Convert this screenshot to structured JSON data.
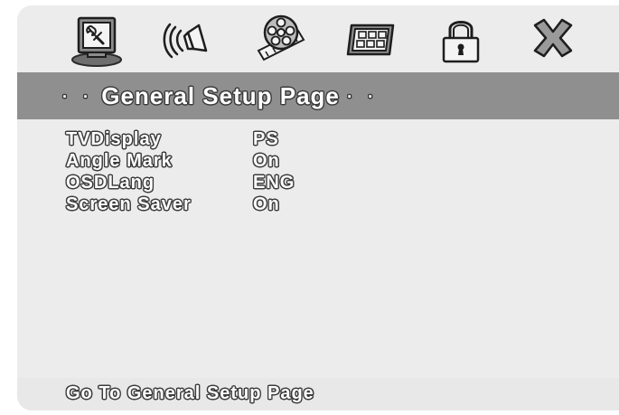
{
  "toolbar": {
    "icons": [
      {
        "name": "general-setup-icon",
        "selected": true
      },
      {
        "name": "audio-setup-icon",
        "selected": false
      },
      {
        "name": "video-setup-icon",
        "selected": false
      },
      {
        "name": "preference-icon",
        "selected": false
      },
      {
        "name": "password-lock-icon",
        "selected": false
      },
      {
        "name": "exit-icon",
        "selected": false
      }
    ]
  },
  "page": {
    "dots_left": "· ·",
    "title": "General Setup Page",
    "dots_right": "· ·"
  },
  "settings": [
    {
      "label": "TVDisplay",
      "value": "PS"
    },
    {
      "label": "Angle Mark",
      "value": "On"
    },
    {
      "label": "OSDLang",
      "value": "ENG"
    },
    {
      "label": "Screen Saver",
      "value": "On"
    }
  ],
  "status": {
    "text": "Go To General Setup Page"
  },
  "colors": {
    "background": "#ececec",
    "title_bar": "#8f8f8f",
    "text_fill": "#ffffff",
    "text_outline": "#3c3c3c"
  }
}
